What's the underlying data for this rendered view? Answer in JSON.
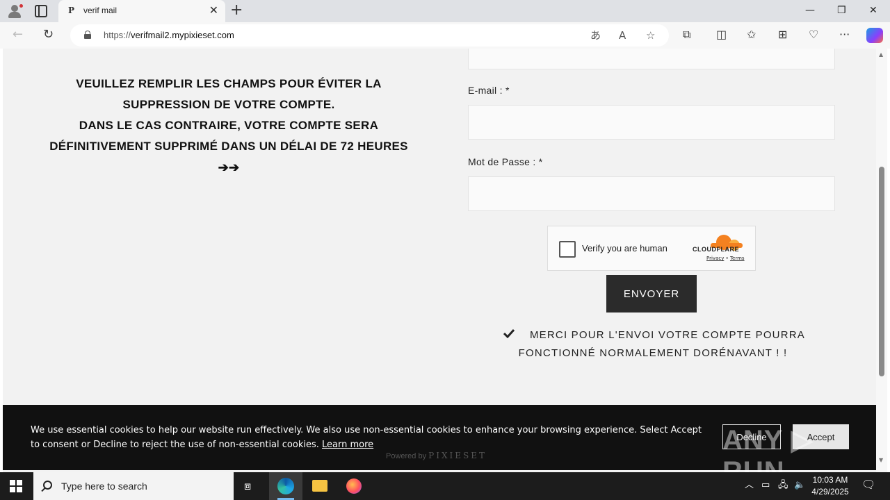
{
  "browser": {
    "tab_title": "verif mail",
    "tab_favicon": "P",
    "url_prefix": "https://",
    "url_host": "verifmail2.mypixieset.com",
    "icons": [
      "profile-icon",
      "tabs-icon",
      "close-tab-icon",
      "new-tab-icon",
      "back-icon",
      "refresh-icon",
      "lock-icon",
      "translate-icon",
      "read-aloud-icon",
      "favorite-icon",
      "extensions-icon",
      "split-screen-icon",
      "favorites-icon",
      "collections-icon",
      "browser-essentials-icon",
      "more-icon",
      "copilot-icon"
    ]
  },
  "page": {
    "warning_line1": "VEUILLEZ REMPLIR LES CHAMPS POUR ÉVITER LA",
    "warning_line2": "SUPPRESSION DE VOTRE COMPTE.",
    "warning_line3": "DANS LE CAS CONTRAIRE, VOTRE COMPTE SERA",
    "warning_line4": "DÉFINITIVEMENT SUPPRIMÉ DANS UN DÉLAI DE 72 HEURES",
    "warning_arrows": "➔➔",
    "email_label": "E-mail : *",
    "email_value": "",
    "password_label": "Mot de Passe : *",
    "password_value": "",
    "captcha_text": "Verify you are human",
    "captcha_brand": "CLOUDFLARE",
    "captcha_privacy": "Privacy",
    "captcha_sep": " • ",
    "captcha_terms": "Terms",
    "send_label": "ENVOYER",
    "success_line1": "MERCI POUR L'ENVOI VOTRE COMPTE POURRA",
    "success_line2": "FONCTIONNÉ NORMALEMENT DORÉNAVANT ! !"
  },
  "cookie": {
    "text": "We use essential cookies to help our website run effectively. We also use non-essential cookies to enhance your browsing experience. Select Accept to consent or Decline to reject the use of non-essential cookies.",
    "learn_more": "Learn more",
    "decline": "Decline",
    "accept": "Accept",
    "powered_by": "Powered by",
    "powered_brand": "PIXIESET",
    "watermark": "ANY ▷ RUN"
  },
  "taskbar": {
    "search_placeholder": "Type here to search",
    "time": "10:03 AM",
    "date": "4/29/2025"
  },
  "colors": {
    "button_dark": "#2b2b2b",
    "page_bg": "#f2f2f2",
    "cloudflare_orange": "#f48120"
  }
}
